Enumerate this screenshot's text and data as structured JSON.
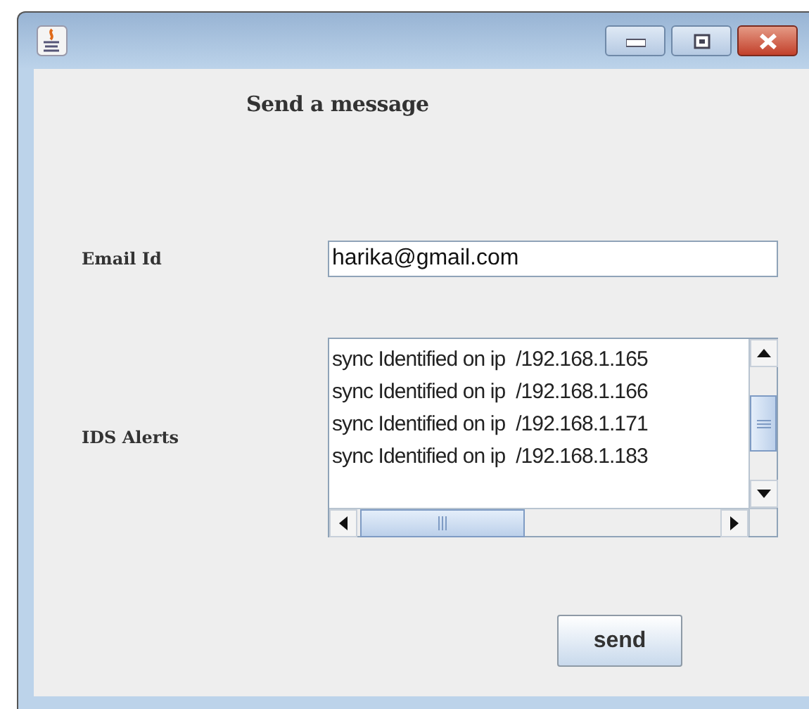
{
  "window": {
    "controls": [
      {
        "kind": "minimize"
      },
      {
        "kind": "maximize"
      },
      {
        "kind": "close"
      }
    ]
  },
  "heading": "Send a message",
  "email": {
    "label": "Email Id",
    "value": "harika@gmail.com"
  },
  "alerts": {
    "label": "IDS Alerts",
    "lines": [
      "sync Identified on ip  /192.168.1.165",
      "sync Identified on ip  /192.168.1.166",
      "sync Identified on ip  /192.168.1.171",
      "sync Identified on ip  /192.168.1.183"
    ]
  },
  "buttons": [
    "send"
  ]
}
